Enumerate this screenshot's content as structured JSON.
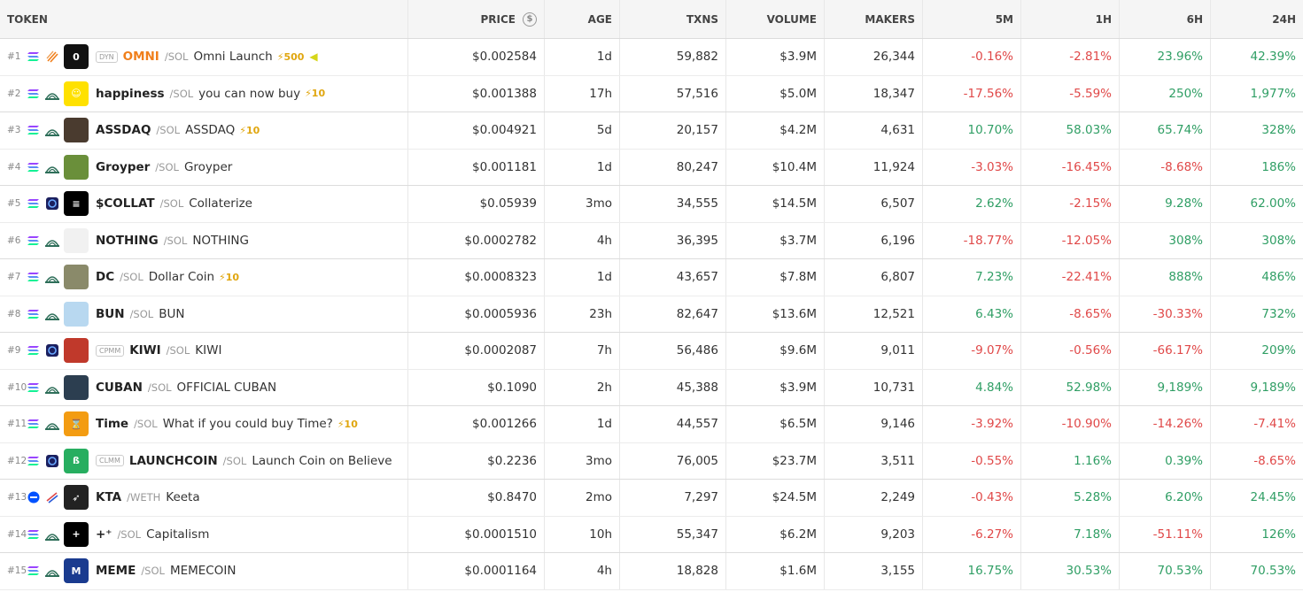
{
  "headers": {
    "token": "TOKEN",
    "price": "PRICE",
    "age": "AGE",
    "txns": "TXNS",
    "volume": "VOLUME",
    "makers": "MAKERS",
    "m5": "5M",
    "h1": "1H",
    "h6": "6H",
    "h24": "24H"
  },
  "colors": {
    "positive": "#2f9e64",
    "negative": "#e04848",
    "symbol_highlight": "#f07f1b",
    "boost": "#e0a60f"
  },
  "rows": [
    {
      "rank": "#1",
      "chain_icon": "solana-icon",
      "dex_icon": "flame-dex-icon",
      "avatar_icon": "omni-logo",
      "badge": "DYN",
      "symbol": "OMNI",
      "quote": "/SOL",
      "name": "Omni Launch",
      "boost": "⚡500",
      "extra_icon": "megaphone-icon",
      "price": "$0.002584",
      "age": "1d",
      "txns": "59,882",
      "volume": "$3.9M",
      "makers": "26,344",
      "m5": "-0.16%",
      "h1": "-2.81%",
      "h6": "23.96%",
      "h24": "42.39%"
    },
    {
      "rank": "#2",
      "chain_icon": "solana-icon",
      "dex_icon": "pumpswap-icon",
      "avatar_icon": "smiley-logo",
      "badge": "",
      "symbol": "happiness",
      "quote": "/SOL",
      "name": "you can now buy",
      "boost": "⚡10",
      "price": "$0.001388",
      "age": "17h",
      "txns": "57,516",
      "volume": "$5.0M",
      "makers": "18,347",
      "m5": "-17.56%",
      "h1": "-5.59%",
      "h6": "250%",
      "h24": "1,977%"
    },
    {
      "rank": "#3",
      "chain_icon": "solana-icon",
      "dex_icon": "pumpswap-icon",
      "avatar_icon": "assdaq-logo",
      "badge": "",
      "symbol": "ASSDAQ",
      "quote": "/SOL",
      "name": "ASSDAQ",
      "boost": "⚡10",
      "price": "$0.004921",
      "age": "5d",
      "txns": "20,157",
      "volume": "$4.2M",
      "makers": "4,631",
      "m5": "10.70%",
      "h1": "58.03%",
      "h6": "65.74%",
      "h24": "328%"
    },
    {
      "rank": "#4",
      "chain_icon": "solana-icon",
      "dex_icon": "pumpswap-icon",
      "avatar_icon": "groyper-logo",
      "badge": "",
      "symbol": "Groyper",
      "quote": "/SOL",
      "name": "Groyper",
      "boost": "",
      "price": "$0.001181",
      "age": "1d",
      "txns": "80,247",
      "volume": "$10.4M",
      "makers": "11,924",
      "m5": "-3.03%",
      "h1": "-16.45%",
      "h6": "-8.68%",
      "h24": "186%"
    },
    {
      "rank": "#5",
      "chain_icon": "solana-icon",
      "dex_icon": "raydium-icon",
      "avatar_icon": "collat-logo",
      "badge": "",
      "symbol": "$COLLAT",
      "quote": "/SOL",
      "name": "Collaterize",
      "boost": "",
      "price": "$0.05939",
      "age": "3mo",
      "txns": "34,555",
      "volume": "$14.5M",
      "makers": "6,507",
      "m5": "2.62%",
      "h1": "-2.15%",
      "h6": "9.28%",
      "h24": "62.00%"
    },
    {
      "rank": "#6",
      "chain_icon": "solana-icon",
      "dex_icon": "pumpswap-icon",
      "avatar_icon": "nothing-logo",
      "badge": "",
      "symbol": "NOTHING",
      "quote": "/SOL",
      "name": "NOTHING",
      "boost": "",
      "price": "$0.0002782",
      "age": "4h",
      "txns": "36,395",
      "volume": "$3.7M",
      "makers": "6,196",
      "m5": "-18.77%",
      "h1": "-12.05%",
      "h6": "308%",
      "h24": "308%"
    },
    {
      "rank": "#7",
      "chain_icon": "solana-icon",
      "dex_icon": "pumpswap-icon",
      "avatar_icon": "dollar-coin-logo",
      "badge": "",
      "symbol": "DC",
      "quote": "/SOL",
      "name": "Dollar Coin",
      "boost": "⚡10",
      "price": "$0.0008323",
      "age": "1d",
      "txns": "43,657",
      "volume": "$7.8M",
      "makers": "6,807",
      "m5": "7.23%",
      "h1": "-22.41%",
      "h6": "888%",
      "h24": "486%"
    },
    {
      "rank": "#8",
      "chain_icon": "solana-icon",
      "dex_icon": "pumpswap-icon",
      "avatar_icon": "bun-logo",
      "badge": "",
      "symbol": "BUN",
      "quote": "/SOL",
      "name": "BUN",
      "boost": "",
      "price": "$0.0005936",
      "age": "23h",
      "txns": "82,647",
      "volume": "$13.6M",
      "makers": "12,521",
      "m5": "6.43%",
      "h1": "-8.65%",
      "h6": "-30.33%",
      "h24": "732%"
    },
    {
      "rank": "#9",
      "chain_icon": "solana-icon",
      "dex_icon": "raydium-icon",
      "avatar_icon": "kiwi-logo",
      "badge": "CPMM",
      "symbol": "KIWI",
      "quote": "/SOL",
      "name": "KIWI",
      "boost": "",
      "price": "$0.0002087",
      "age": "7h",
      "txns": "56,486",
      "volume": "$9.6M",
      "makers": "9,011",
      "m5": "-9.07%",
      "h1": "-0.56%",
      "h6": "-66.17%",
      "h24": "209%"
    },
    {
      "rank": "#10",
      "chain_icon": "solana-icon",
      "dex_icon": "pumpswap-icon",
      "avatar_icon": "cuban-logo",
      "badge": "",
      "symbol": "CUBAN",
      "quote": "/SOL",
      "name": "OFFICIAL CUBAN",
      "boost": "",
      "price": "$0.1090",
      "age": "2h",
      "txns": "45,388",
      "volume": "$3.9M",
      "makers": "10,731",
      "m5": "4.84%",
      "h1": "52.98%",
      "h6": "9,189%",
      "h24": "9,189%"
    },
    {
      "rank": "#11",
      "chain_icon": "solana-icon",
      "dex_icon": "pumpswap-icon",
      "avatar_icon": "time-logo",
      "badge": "",
      "symbol": "Time",
      "quote": "/SOL",
      "name": "What if you could buy Time?",
      "boost": "⚡10",
      "price": "$0.001266",
      "age": "1d",
      "txns": "44,557",
      "volume": "$6.5M",
      "makers": "9,146",
      "m5": "-3.92%",
      "h1": "-10.90%",
      "h6": "-14.26%",
      "h24": "-7.41%"
    },
    {
      "rank": "#12",
      "chain_icon": "solana-icon",
      "dex_icon": "raydium-icon",
      "avatar_icon": "launchcoin-logo",
      "badge": "CLMM",
      "symbol": "LAUNCHCOIN",
      "quote": "/SOL",
      "name": "Launch Coin on Believe",
      "boost": "",
      "price": "$0.2236",
      "age": "3mo",
      "txns": "76,005",
      "volume": "$23.7M",
      "makers": "3,511",
      "m5": "-0.55%",
      "h1": "1.16%",
      "h6": "0.39%",
      "h24": "-8.65%"
    },
    {
      "rank": "#13",
      "chain_icon": "base-icon",
      "dex_icon": "aerodrome-icon",
      "avatar_icon": "keeta-logo",
      "badge": "",
      "symbol": "KTA",
      "quote": "/WETH",
      "name": "Keeta",
      "boost": "",
      "price": "$0.8470",
      "age": "2mo",
      "txns": "7,297",
      "volume": "$24.5M",
      "makers": "2,249",
      "m5": "-0.43%",
      "h1": "5.28%",
      "h6": "6.20%",
      "h24": "24.45%"
    },
    {
      "rank": "#14",
      "chain_icon": "solana-icon",
      "dex_icon": "pumpswap-icon",
      "avatar_icon": "capitalism-logo",
      "badge": "",
      "symbol": "+⁺",
      "quote": "/SOL",
      "name": "Capitalism",
      "boost": "",
      "price": "$0.0001510",
      "age": "10h",
      "txns": "55,347",
      "volume": "$6.2M",
      "makers": "9,203",
      "m5": "-6.27%",
      "h1": "7.18%",
      "h6": "-51.11%",
      "h24": "126%"
    },
    {
      "rank": "#15",
      "chain_icon": "solana-icon",
      "dex_icon": "pumpswap-icon",
      "avatar_icon": "memecoin-logo",
      "badge": "",
      "symbol": "MEME",
      "quote": "/SOL",
      "name": "MEMECOIN",
      "boost": "",
      "price": "$0.0001164",
      "age": "4h",
      "txns": "18,828",
      "volume": "$1.6M",
      "makers": "3,155",
      "m5": "16.75%",
      "h1": "30.53%",
      "h6": "70.53%",
      "h24": "70.53%"
    }
  ]
}
